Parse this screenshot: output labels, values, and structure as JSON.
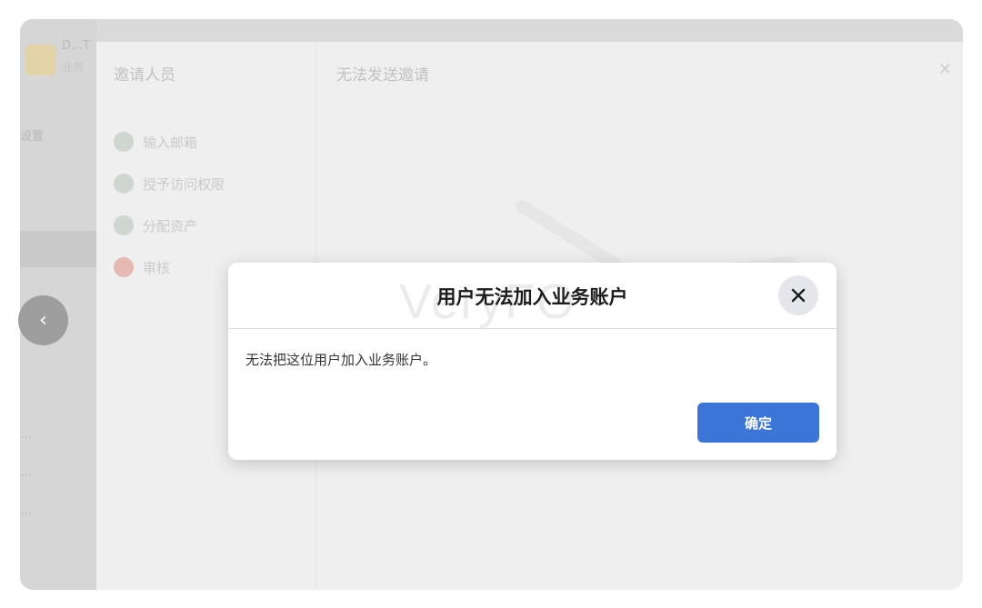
{
  "background": {
    "app": {
      "name": "D…T",
      "subtitle": "业务",
      "nav_items": [
        "设置",
        "",
        "…",
        "…",
        "…"
      ]
    },
    "invite_panel": {
      "steps_title": "邀请人员",
      "steps": [
        {
          "label": "输入邮箱",
          "state": "done"
        },
        {
          "label": "授予访问权限",
          "state": "done"
        },
        {
          "label": "分配资产",
          "state": "done"
        },
        {
          "label": "审核",
          "state": "error"
        }
      ],
      "title": "无法发送邀请",
      "close_icon": "close-icon"
    }
  },
  "carousel": {
    "prev_glyph": "‹"
  },
  "dialog": {
    "title": "用户无法加入业务账户",
    "watermark": "VeryFO",
    "message": "无法把这位用户加入业务账户。",
    "ok_label": "确定",
    "close_glyph": "✕"
  },
  "colors": {
    "primary_button": "#3c75d6",
    "close_button_bg": "#e4e6eb"
  }
}
